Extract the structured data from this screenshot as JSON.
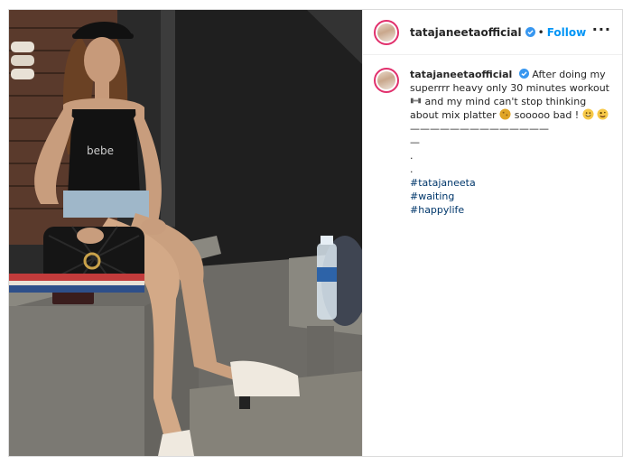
{
  "post": {
    "username": "tatajaneetaofficial",
    "follow_label": "Follow",
    "separator": "•",
    "more_label": "···"
  },
  "caption": {
    "username": "tatajaneetaofficial",
    "text_1": "After doing my superrrr heavy only 30 minutes workout",
    "text_2": "and my mind can't stop thinking about mix platter",
    "text_3": "sooooo bad !",
    "divider_1": "——————————————",
    "divider_2": "—",
    "dot_1": ".",
    "dot_2": ".",
    "hashtags": [
      "#tatajaneeta",
      "#waiting",
      "#happylife"
    ]
  },
  "colors": {
    "accent": "#0095f6",
    "hashtag": "#00376b",
    "verified": "#3897f0",
    "ring": "#e1306c"
  },
  "icons": {
    "verified": "verified-badge-icon",
    "dumbbell": "dumbbell-emoji",
    "platter": "cookie-emoji",
    "grin": "grinning-emoji",
    "silly": "zany-emoji",
    "more": "more-options-icon"
  }
}
